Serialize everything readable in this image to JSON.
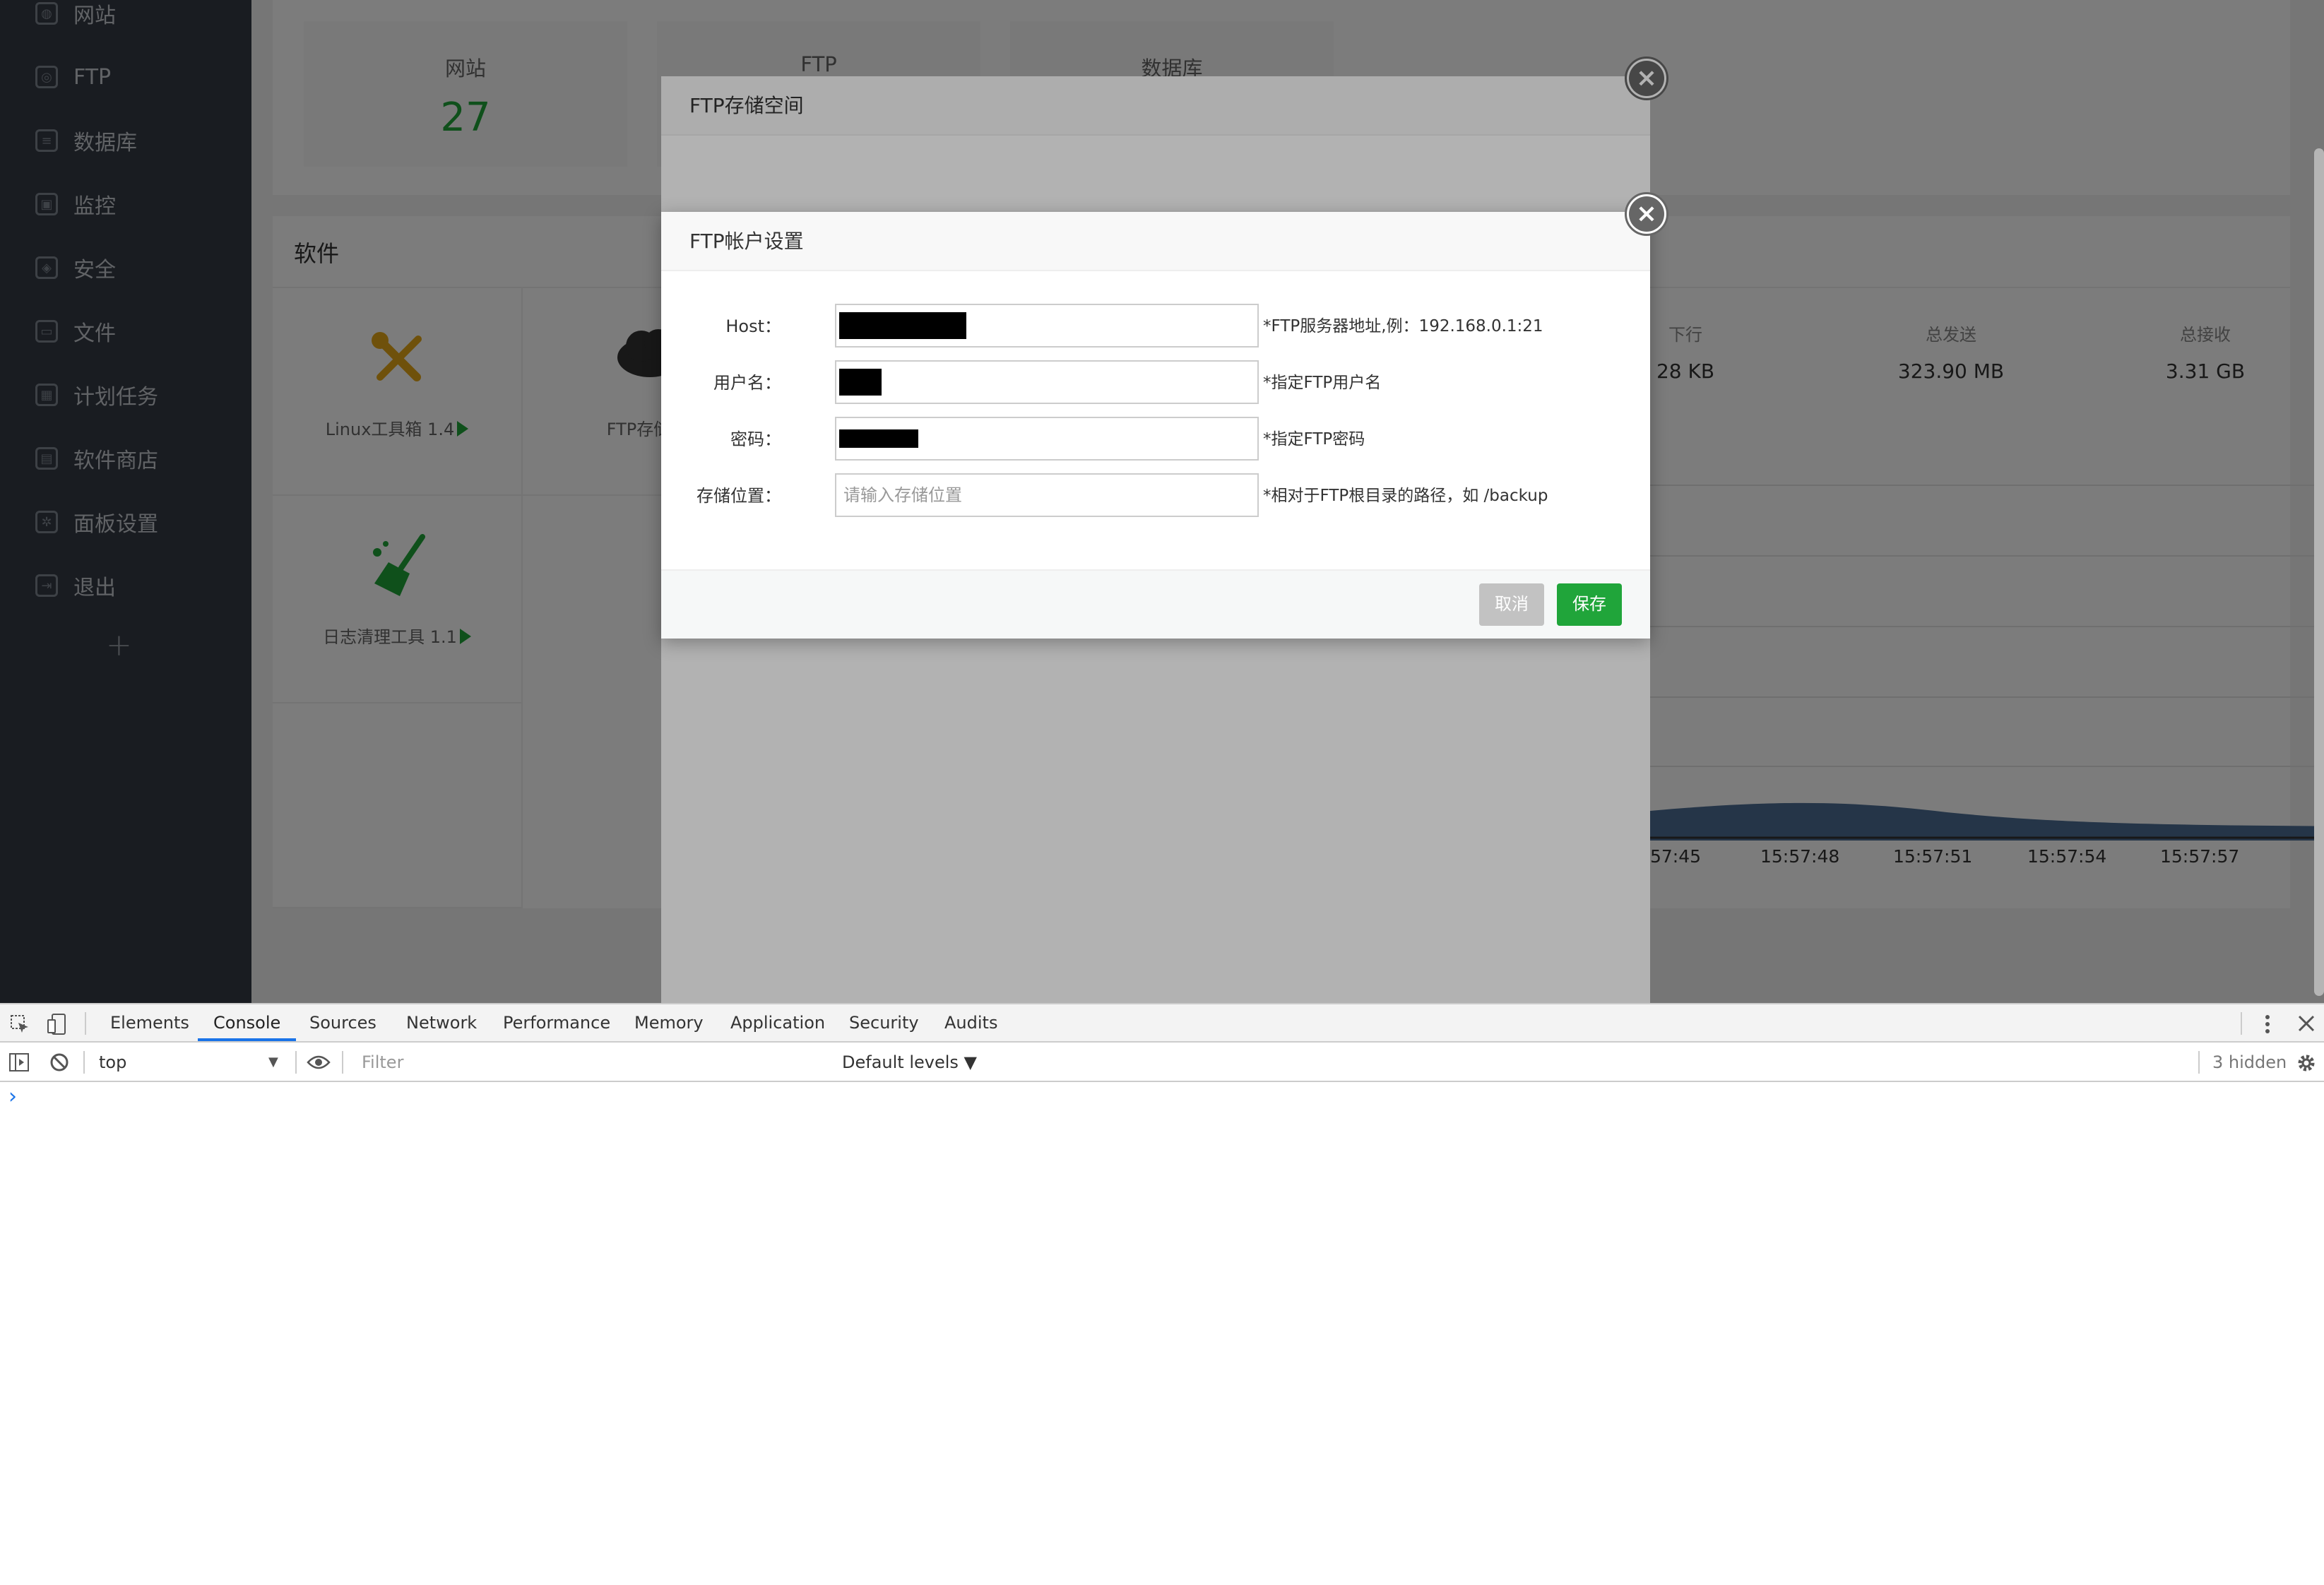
{
  "sidebar": {
    "items": [
      {
        "label": "网站",
        "icon": "globe-icon"
      },
      {
        "label": "FTP",
        "icon": "ftp-icon"
      },
      {
        "label": "数据库",
        "icon": "database-icon"
      },
      {
        "label": "监控",
        "icon": "monitor-icon"
      },
      {
        "label": "安全",
        "icon": "shield-icon"
      },
      {
        "label": "文件",
        "icon": "folder-icon"
      },
      {
        "label": "计划任务",
        "icon": "calendar-icon"
      },
      {
        "label": "软件商店",
        "icon": "grid-icon"
      },
      {
        "label": "面板设置",
        "icon": "gear-icon"
      },
      {
        "label": "退出",
        "icon": "logout-icon"
      }
    ],
    "add_label": "+"
  },
  "stats": [
    {
      "label": "网站",
      "value": "27"
    },
    {
      "label": "FTP",
      "value": ""
    },
    {
      "label": "数据库",
      "value": ""
    }
  ],
  "software": {
    "title": "软件",
    "items": [
      {
        "label": "Linux工具箱 1.4",
        "icon": "tools-icon"
      },
      {
        "label": "FTP存储空",
        "icon": "cloud-ftp-icon"
      },
      {
        "label": "日志清理工具 1.1",
        "icon": "broom-icon"
      }
    ]
  },
  "network": {
    "items": [
      {
        "label": "下行",
        "value": "28 KB"
      },
      {
        "label": "总发送",
        "value": "323.90 MB"
      },
      {
        "label": "总接收",
        "value": "3.31 GB"
      }
    ],
    "ticks": [
      "57:45",
      "15:57:48",
      "15:57:51",
      "15:57:54",
      "15:57:57"
    ]
  },
  "dialog_back": {
    "title": "FTP存储空间",
    "close_label": "×"
  },
  "dialog_front": {
    "title": "FTP帐户设置",
    "close_label": "×",
    "fields": [
      {
        "label": "Host：",
        "value": "",
        "placeholder": "",
        "hint": "*FTP服务器地址,例：192.168.0.1:21"
      },
      {
        "label": "用户名：",
        "value": "",
        "placeholder": "",
        "hint": "*指定FTP用户名"
      },
      {
        "label": "密码：",
        "value": "",
        "placeholder": "",
        "hint": "*指定FTP密码"
      },
      {
        "label": "存储位置：",
        "value": "",
        "placeholder": "请输入存储位置",
        "hint": "*相对于FTP根目录的路径，如 /backup"
      }
    ],
    "cancel_label": "取消",
    "save_label": "保存",
    "cancel_color": "#c2c2c2",
    "save_color": "#20a53a"
  },
  "devtools": {
    "tabs": [
      "Elements",
      "Console",
      "Sources",
      "Network",
      "Performance",
      "Memory",
      "Application",
      "Security",
      "Audits"
    ],
    "active_tab": "Console",
    "context": "top",
    "filter_placeholder": "Filter",
    "levels": "Default levels ▼",
    "hidden": "3 hidden",
    "prompt": "›"
  },
  "colors": {
    "accent": "#20a53a",
    "sidebar_bg": "#353b45",
    "devtools_active": "#1a73e8"
  }
}
